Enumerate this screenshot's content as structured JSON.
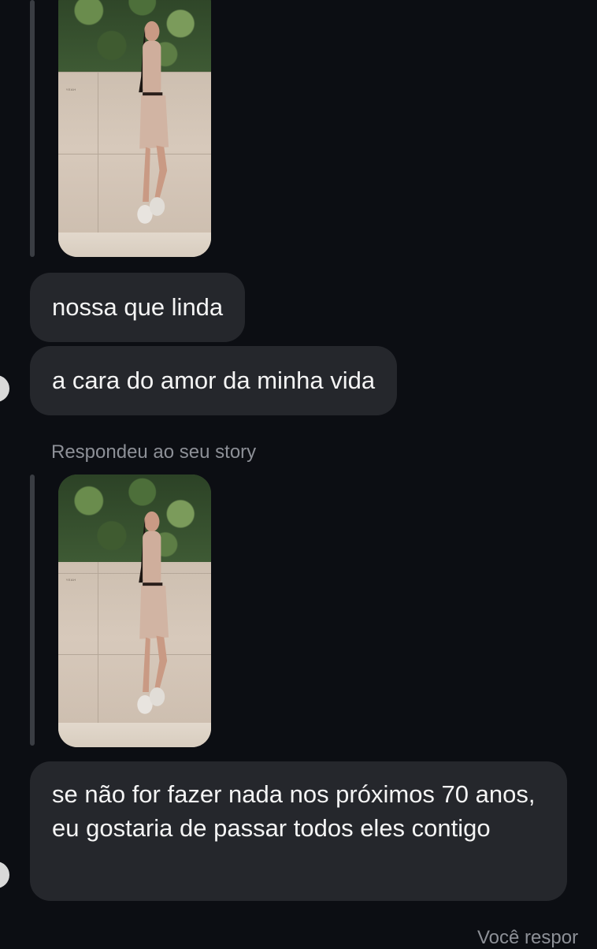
{
  "messages": [
    {
      "type": "story-reply-image"
    },
    {
      "type": "text",
      "text": "nossa que linda"
    },
    {
      "type": "text",
      "text": "a cara do amor da minha vida"
    },
    {
      "type": "meta",
      "text": "Respondeu ao seu story"
    },
    {
      "type": "story-reply-image"
    },
    {
      "type": "text",
      "text": "se não for fazer nada nos próximos 70 anos, eu gostaria de passar todos eles contigo"
    },
    {
      "type": "meta",
      "text": "Você respor"
    }
  ],
  "colors": {
    "background": "#0c0e13",
    "bubble": "#25272c",
    "meta_text": "#8d9097",
    "reply_bar": "#3a3d43"
  }
}
